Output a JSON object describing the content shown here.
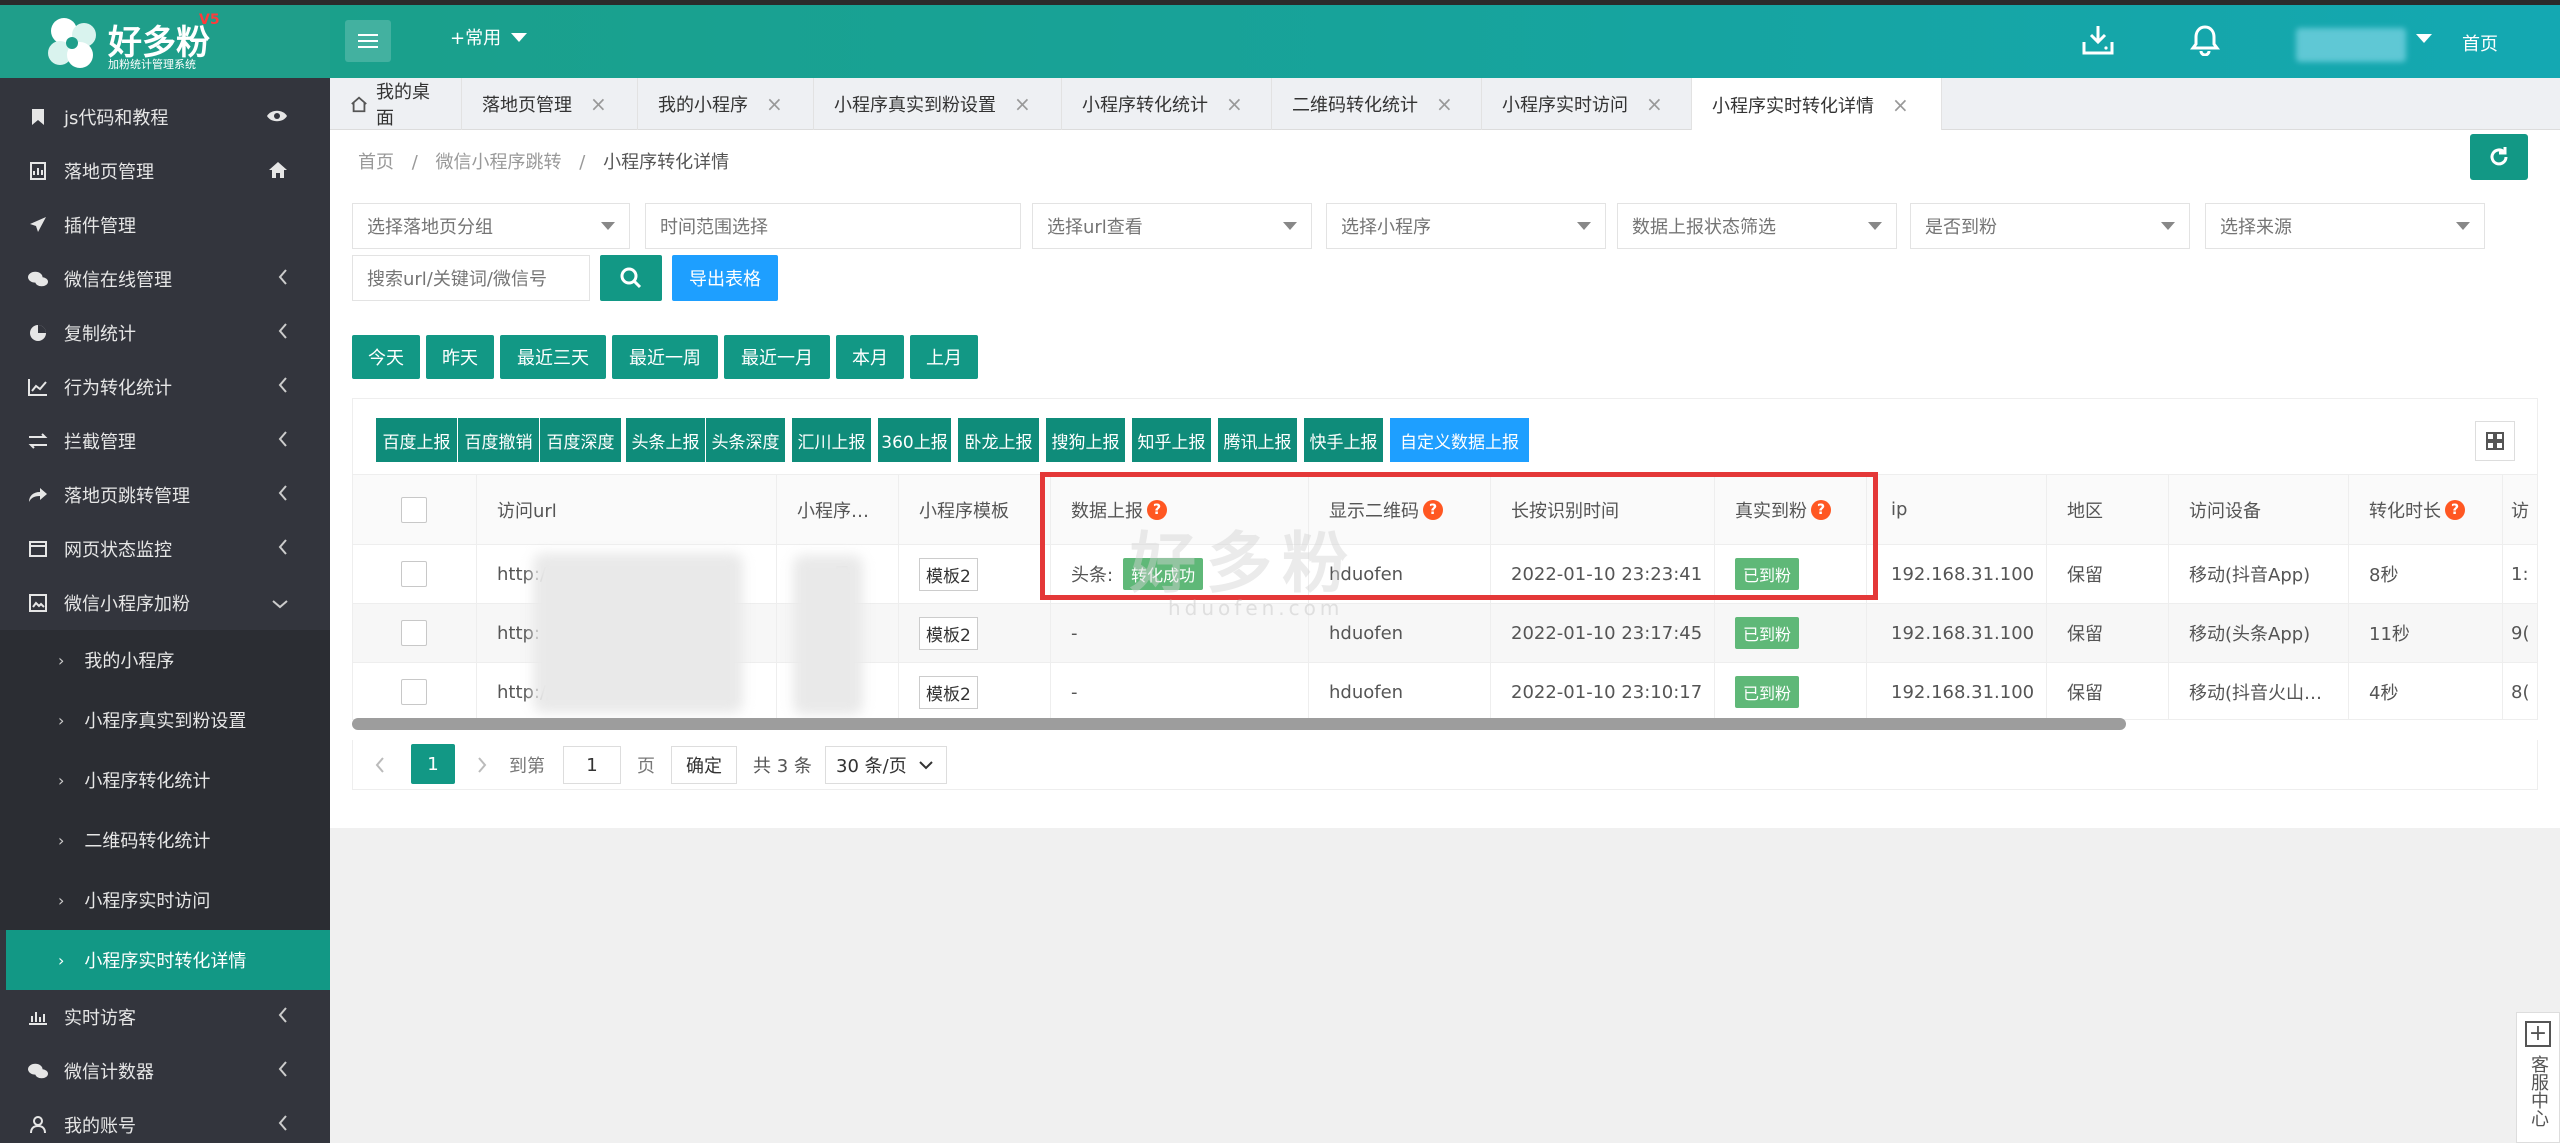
{
  "brand": {
    "name": "好多粉",
    "version": "V5",
    "subtitle": "加粉统计管理系统"
  },
  "header": {
    "common_label": "+常用",
    "home_label": "首页"
  },
  "sidebar": {
    "items": [
      {
        "label": "js代码和教程"
      },
      {
        "label": "落地页管理"
      },
      {
        "label": "插件管理"
      },
      {
        "label": "微信在线管理"
      },
      {
        "label": "复制统计"
      },
      {
        "label": "行为转化统计"
      },
      {
        "label": "拦截管理"
      },
      {
        "label": "落地页跳转管理"
      },
      {
        "label": "网页状态监控"
      },
      {
        "label": "微信小程序加粉"
      }
    ],
    "subitems": [
      {
        "label": "我的小程序"
      },
      {
        "label": "小程序真实到粉设置"
      },
      {
        "label": "小程序转化统计"
      },
      {
        "label": "二维码转化统计"
      },
      {
        "label": "小程序实时访问"
      },
      {
        "label": "小程序实时转化详情"
      }
    ],
    "bottom_items": [
      {
        "label": "实时访客"
      },
      {
        "label": "微信计数器"
      },
      {
        "label": "我的账号"
      }
    ]
  },
  "tabs": [
    {
      "label": "我的桌面"
    },
    {
      "label": "落地页管理"
    },
    {
      "label": "我的小程序"
    },
    {
      "label": "小程序真实到粉设置"
    },
    {
      "label": "小程序转化统计"
    },
    {
      "label": "二维码转化统计"
    },
    {
      "label": "小程序实时访问"
    },
    {
      "label": "小程序实时转化详情"
    }
  ],
  "breadcrumb": {
    "home": "首页",
    "sep": "/",
    "parent": "微信小程序跳转",
    "current": "小程序转化详情"
  },
  "filters": {
    "group": "选择落地页分组",
    "time": "时间范围选择",
    "url": "选择url查看",
    "miniapp": "选择小程序",
    "report_status": "数据上报状态筛选",
    "arrived": "是否到粉",
    "source": "选择来源",
    "search_placeholder": "搜索url/关键词/微信号",
    "export": "导出表格"
  },
  "date_buttons": [
    "今天",
    "昨天",
    "最近三天",
    "最近一周",
    "最近一月",
    "本月",
    "上月"
  ],
  "report_buttons": [
    "百度上报",
    "百度撤销",
    "百度深度",
    "头条上报",
    "头条深度",
    "汇川上报",
    "360上报",
    "卧龙上报",
    "搜狗上报",
    "知乎上报",
    "腾讯上报",
    "快手上报",
    "自定义数据上报"
  ],
  "table": {
    "headers": [
      "访问url",
      "小程序…",
      "小程序模板",
      "数据上报",
      "显示二维码",
      "长按识别时间",
      "真实到粉",
      "ip",
      "地区",
      "访问设备",
      "转化时长",
      "访"
    ],
    "rows": [
      {
        "url": "http:/",
        "miniapp": "号",
        "template": "模板2",
        "report_prefix": "头条:",
        "report_badge": "转化成功",
        "qrcode": "hduofen",
        "time": "2022-01-10 23:23:41",
        "arrived": "已到粉",
        "ip": "192.168.31.100",
        "region": "保留",
        "device": "移动(抖音App)",
        "duration": "8秒",
        "visit": "1:"
      },
      {
        "url": "http:",
        "miniapp": "",
        "template": "模板2",
        "report_prefix": "-",
        "report_badge": "",
        "qrcode": "hduofen",
        "time": "2022-01-10 23:17:45",
        "arrived": "已到粉",
        "ip": "192.168.31.100",
        "region": "保留",
        "device": "移动(头条App)",
        "duration": "11秒",
        "visit": "9("
      },
      {
        "url": "http://",
        "miniapp": "ー",
        "template": "模板2",
        "report_prefix": "-",
        "report_badge": "",
        "qrcode": "hduofen",
        "time": "2022-01-10 23:10:17",
        "arrived": "已到粉",
        "ip": "192.168.31.100",
        "region": "保留",
        "device": "移动(抖音火山…",
        "duration": "4秒",
        "visit": "8("
      }
    ]
  },
  "pager": {
    "current": "1",
    "goto_label": "到第",
    "goto_value": "1",
    "page_label": "页",
    "confirm": "确定",
    "total": "共 3 条",
    "per_page": "30 条/页"
  },
  "watermark": {
    "cn": "好多粉",
    "en": "hduofen.com"
  },
  "kefu": {
    "label": "客服中心"
  },
  "colors": {
    "primary": "#129885",
    "blue": "#1e9fff",
    "sidebar": "#33353d",
    "badge_green": "#5fb878",
    "highlight_red": "#e43838"
  }
}
